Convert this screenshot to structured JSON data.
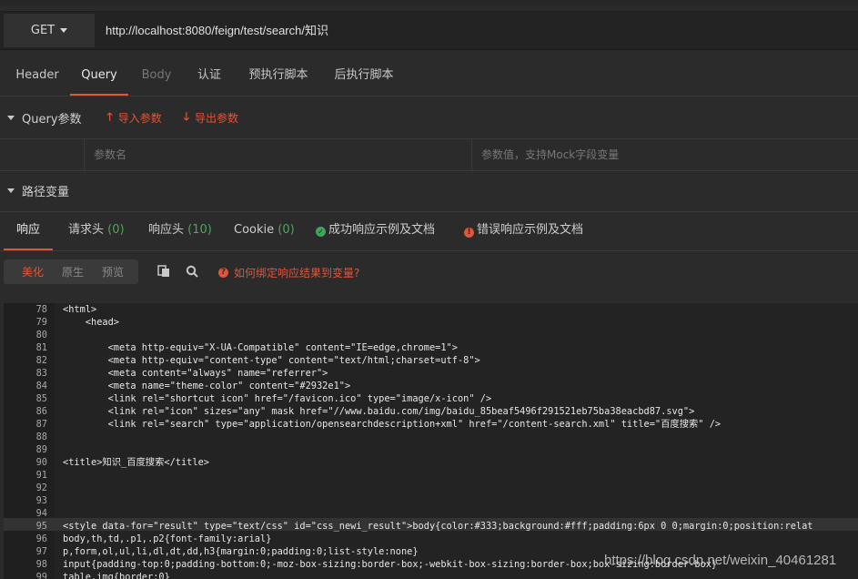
{
  "request": {
    "method": "GET",
    "url": "http://localhost:8080/feign/test/search/知识"
  },
  "request_tabs": [
    "Header",
    "Query",
    "Body",
    "认证",
    "预执行脚本",
    "后执行脚本"
  ],
  "query_section": {
    "title": "Query参数",
    "import_label": "导入参数",
    "export_label": "导出参数",
    "name_placeholder": "参数名",
    "value_placeholder": "参数值，支持Mock字段变量"
  },
  "path_section": {
    "title": "路径变量"
  },
  "response_tabs": {
    "response": "响应",
    "req_headers": "请求头",
    "req_headers_count": "(0)",
    "resp_headers": "响应头",
    "resp_headers_count": "(10)",
    "cookie": "Cookie",
    "cookie_count": "(0)",
    "success_doc": "成功响应示例及文档",
    "error_doc": "错误响应示例及文档"
  },
  "view_modes": [
    "美化",
    "原生",
    "预览"
  ],
  "help_text": "如何绑定响应结果到变量?",
  "code_lines": [
    {
      "n": "78",
      "t": "<html>"
    },
    {
      "n": "79",
      "t": "    <head>"
    },
    {
      "n": "80",
      "t": ""
    },
    {
      "n": "81",
      "t": "        <meta http-equiv=\"X-UA-Compatible\" content=\"IE=edge,chrome=1\">"
    },
    {
      "n": "82",
      "t": "        <meta http-equiv=\"content-type\" content=\"text/html;charset=utf-8\">"
    },
    {
      "n": "83",
      "t": "        <meta content=\"always\" name=\"referrer\">"
    },
    {
      "n": "84",
      "t": "        <meta name=\"theme-color\" content=\"#2932e1\">"
    },
    {
      "n": "85",
      "t": "        <link rel=\"shortcut icon\" href=\"/favicon.ico\" type=\"image/x-icon\" />"
    },
    {
      "n": "86",
      "t": "        <link rel=\"icon\" sizes=\"any\" mask href=\"//www.baidu.com/img/baidu_85beaf5496f291521eb75ba38eacbd87.svg\">"
    },
    {
      "n": "87",
      "t": "        <link rel=\"search\" type=\"application/opensearchdescription+xml\" href=\"/content-search.xml\" title=\"百度搜索\" />"
    },
    {
      "n": "88",
      "t": ""
    },
    {
      "n": "89",
      "t": ""
    },
    {
      "n": "90",
      "t": "<title>知识_百度搜索</title>"
    },
    {
      "n": "91",
      "t": ""
    },
    {
      "n": "92",
      "t": ""
    },
    {
      "n": "93",
      "t": ""
    },
    {
      "n": "94",
      "t": ""
    },
    {
      "n": "95",
      "t": "<style data-for=\"result\" type=\"text/css\" id=\"css_newi_result\">body{color:#333;background:#fff;padding:6px 0 0;margin:0;position:relat"
    },
    {
      "n": "96",
      "t": "body,th,td,.p1,.p2{font-family:arial}"
    },
    {
      "n": "97",
      "t": "p,form,ol,ul,li,dl,dt,dd,h3{margin:0;padding:0;list-style:none}"
    },
    {
      "n": "98",
      "t": "input{padding-top:0;padding-bottom:0;-moz-box-sizing:border-box;-webkit-box-sizing:border-box;box-sizing:border-box}"
    },
    {
      "n": "99",
      "t": "table,img{border:0}"
    }
  ],
  "watermark": "https://blog.csdn.net/weixin_40461281"
}
